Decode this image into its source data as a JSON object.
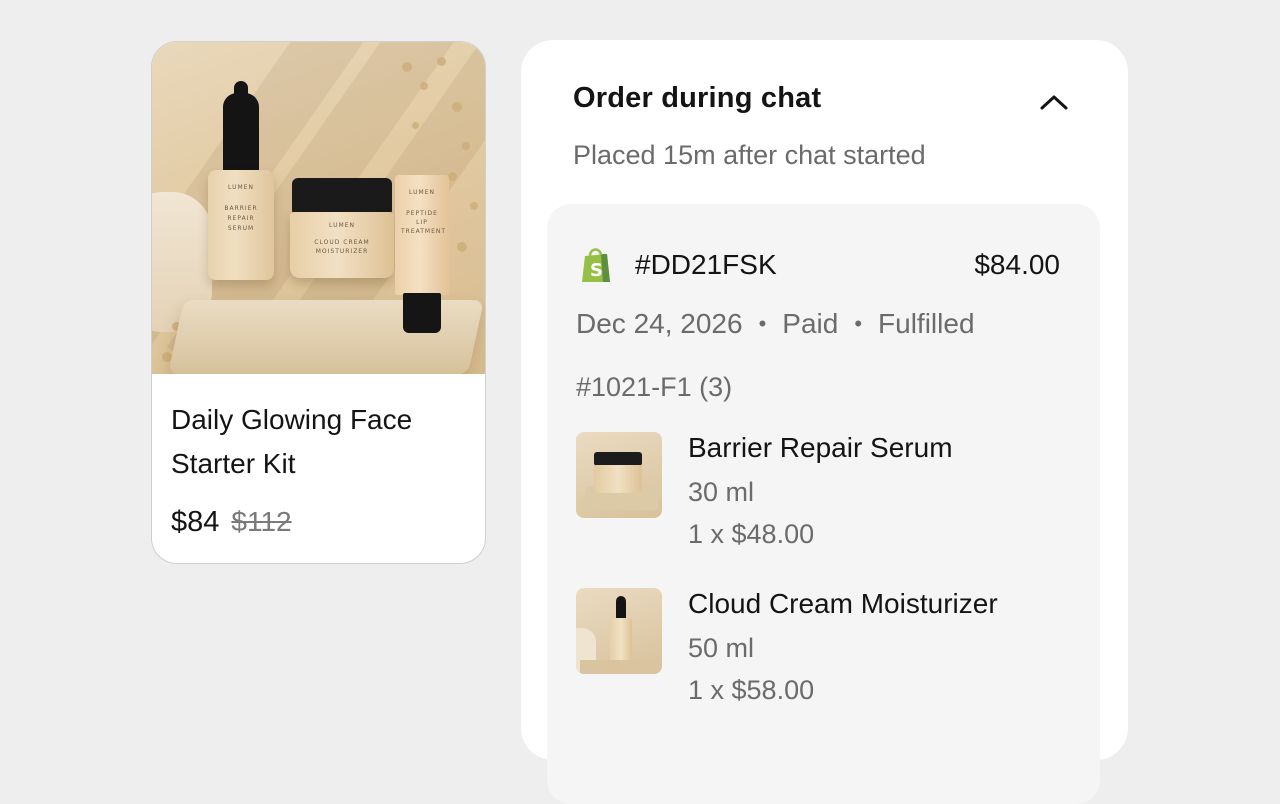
{
  "product_card": {
    "image_icon": "skincare-product-photo",
    "brand_label": "LUMEN",
    "bottle_label": "BARRIER REPAIR SERUM",
    "jar_label": "CLOUD CREAM MOISTURIZER",
    "tube_label": "PEPTIDE LIP TREATMENT",
    "title": "Daily Glowing Face Starter Kit",
    "price": "$84",
    "original_price": "$112"
  },
  "order": {
    "title": "Order during chat",
    "collapse_icon": "chevron-up-icon",
    "subtitle": "Placed 15m after chat started",
    "store_icon": "shopify-bag-icon",
    "store_color": "#95bf47",
    "order_id": "#DD21FSK",
    "total": "$84.00",
    "date": "Dec 24, 2026",
    "payment_status": "Paid",
    "fulfillment_status": "Fulfilled",
    "separator": "•",
    "fulfillment_id": "#1021-F1 (3)",
    "items": [
      {
        "name": "Barrier Repair Serum",
        "variant": "30 ml",
        "quantity_price": "1 x $48.00",
        "thumb_icon": "cream-jar-thumbnail"
      },
      {
        "name": "Cloud Cream Moisturizer",
        "variant": "50 ml",
        "quantity_price": "1 x $58.00",
        "thumb_icon": "serum-bottle-thumbnail"
      }
    ]
  }
}
